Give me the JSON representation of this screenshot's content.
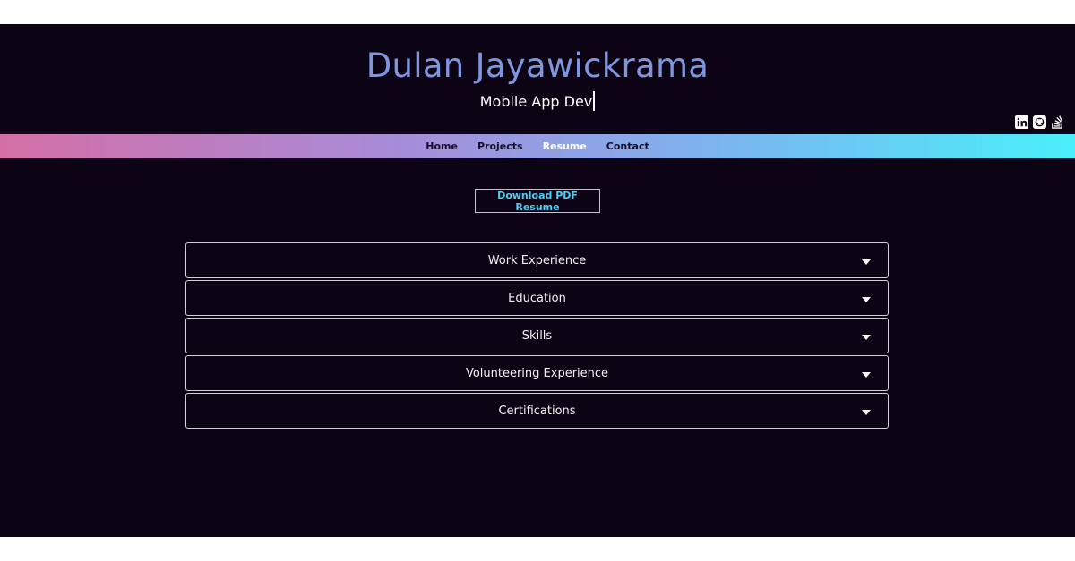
{
  "header": {
    "name": "Dulan Jayawickrama",
    "typed_text": "Mobile App Dev"
  },
  "social": [
    {
      "icon": "linkedin-icon"
    },
    {
      "icon": "github-icon"
    },
    {
      "icon": "stackoverflow-icon"
    }
  ],
  "nav": {
    "items": [
      {
        "label": "Home",
        "active": false
      },
      {
        "label": "Projects",
        "active": false
      },
      {
        "label": "Resume",
        "active": true
      },
      {
        "label": "Contact",
        "active": false
      }
    ]
  },
  "download_button": {
    "label": "Download PDF Resume"
  },
  "sections": [
    {
      "label": "Work Experience"
    },
    {
      "label": "Education"
    },
    {
      "label": "Skills"
    },
    {
      "label": "Volunteering Experience"
    },
    {
      "label": "Certifications"
    }
  ],
  "colors": {
    "background": "#0c0414",
    "name": "#7f95de",
    "gradient_start": "#d46fa6",
    "gradient_end": "#49f0fb",
    "download_text": "#4fcdf5"
  }
}
